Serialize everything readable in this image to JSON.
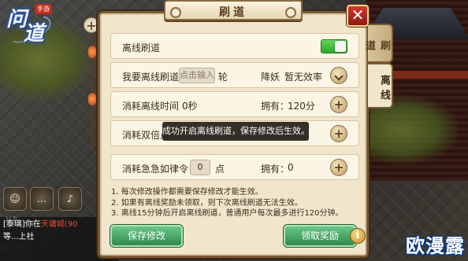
{
  "game": {
    "logo_chars": [
      "问",
      "道"
    ],
    "logo_tag": "手游"
  },
  "dialog": {
    "title": "刷道",
    "close_label": "✕",
    "tabs": [
      {
        "label": "刷道",
        "active": false
      },
      {
        "label": "离线",
        "active": true
      }
    ]
  },
  "rows": {
    "offline": {
      "label": "离线刷道",
      "toggle_on": true
    },
    "rounds": {
      "prefix": "我要离线刷道",
      "input_placeholder": "点击输入",
      "suffix": "轮",
      "mode_label": "降妖",
      "mode_value": "暂无效率"
    },
    "time": {
      "label": "消耗离线时间",
      "value": "0秒",
      "owned_label": "拥有：",
      "owned_value": "120分"
    },
    "double": {
      "label": "消耗双倍点"
    },
    "order": {
      "label": "消耗急急如律令",
      "input_value": "0",
      "unit": "点",
      "owned_label": "拥有：",
      "owned_value": "0"
    }
  },
  "tooltip": "成功开启离线刷道，保存修改后生效。",
  "notes": [
    "1. 每次修改操作都需要保存修改才能生效。",
    "2. 如果有离线奖励未领取，则下次离线刷道无法生效。",
    "3. 离线15分钟后开启离线刷道，普通用户每次最多进行120分钟。"
  ],
  "buttons": {
    "save": "保存修改",
    "claim": "领取奖励",
    "info": "i"
  },
  "side": {
    "plus": "+",
    "icon_label": "好友"
  },
  "chat": {
    "line1_name": "[泰璃]",
    "line1_text": "你在",
    "line1_red": "天墉城(90",
    "line2_text": "等...上社"
  },
  "watermark": "欧漫露",
  "colors": {
    "toggle_on": "#3fb83c",
    "button_green": "#3e9e5c",
    "close_red": "#c0301f",
    "panel_bg": "#f1e6cc"
  }
}
